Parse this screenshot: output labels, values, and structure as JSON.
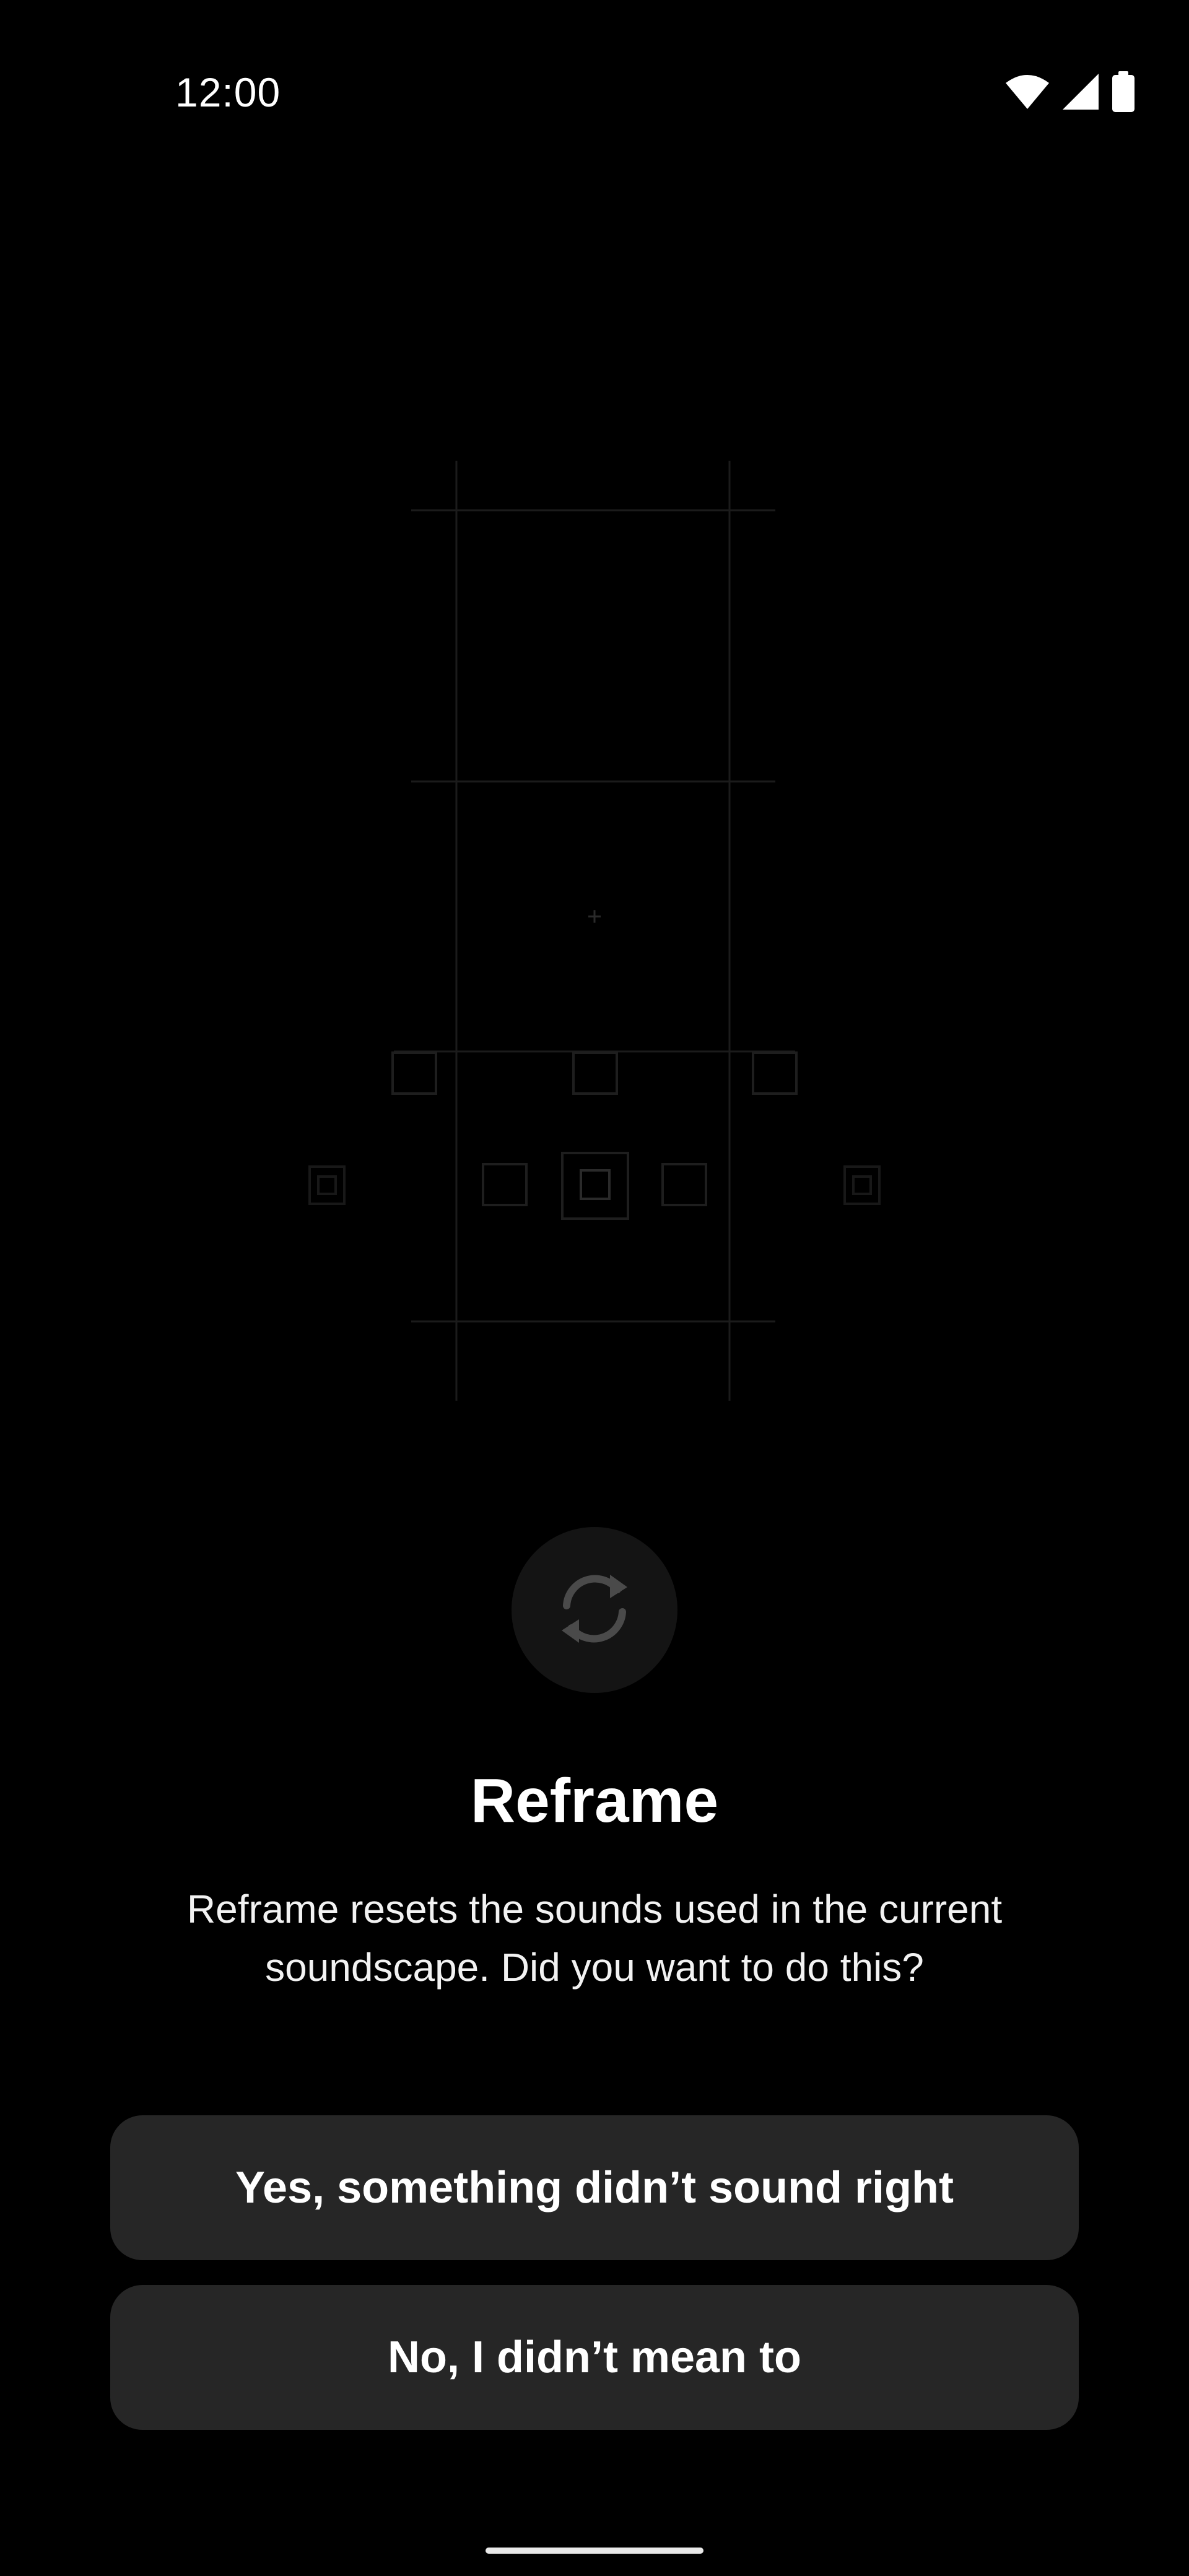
{
  "status_bar": {
    "time": "12:00",
    "icons": [
      "wifi-icon",
      "cellular-signal-icon",
      "battery-icon"
    ]
  },
  "illustration": {
    "description_icon": "speaker-grid-illustration"
  },
  "dialog": {
    "icon": "refresh-icon",
    "title": "Reframe",
    "description": "Reframe resets the sounds used in the current soundscape. Did you want to do this?",
    "yes_label": "Yes, something didn’t sound right",
    "no_label": "No, I didn’t mean to"
  },
  "colors": {
    "background": "#000000",
    "button": "#262626",
    "icon_circle": "#141414",
    "text": "#ffffff"
  }
}
